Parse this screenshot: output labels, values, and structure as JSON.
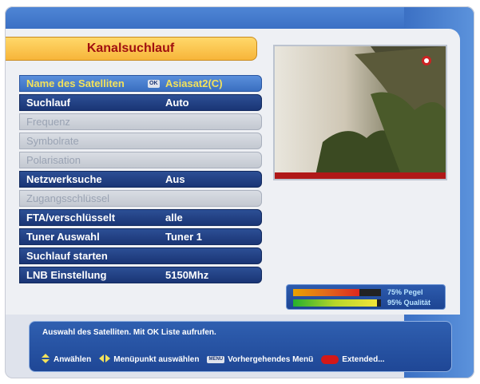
{
  "menu": {
    "title": "Kanalsuchlauf",
    "rows": [
      {
        "label": "Name des Satelliten",
        "value": "Asiasat2(C)",
        "badge": "OK",
        "state": "selected"
      },
      {
        "label": "Suchlauf",
        "value": "Auto",
        "state": "enabled"
      },
      {
        "label": "Frequenz",
        "value": "",
        "state": "disabled"
      },
      {
        "label": "Symbolrate",
        "value": "",
        "state": "disabled"
      },
      {
        "label": "Polarisation",
        "value": "",
        "state": "disabled"
      },
      {
        "label": "Netzwerksuche",
        "value": "Aus",
        "state": "enabled"
      },
      {
        "label": "Zugangsschlüssel",
        "value": "",
        "state": "disabled"
      },
      {
        "label": "FTA/verschlüsselt",
        "value": "alle",
        "state": "enabled"
      },
      {
        "label": "Tuner Auswahl",
        "value": "Tuner 1",
        "state": "enabled"
      },
      {
        "label": "Suchlauf starten",
        "value": "",
        "state": "enabled"
      },
      {
        "label": "LNB Einstellung",
        "value": "5150Mhz",
        "state": "enabled"
      }
    ]
  },
  "signal": {
    "level_text": "75% Pegel",
    "level": 0.75,
    "quality_text": "95% Qualität",
    "quality": 0.95
  },
  "help": {
    "text": "Auswahl des Satelliten. Mit OK Liste aufrufen.",
    "legend": {
      "navigate_label": "Anwählen",
      "select_label": "Menüpunkt auswählen",
      "menu_key": "MENU",
      "back_label": "Vorhergehendes Menü",
      "extended_label": "Extended..."
    }
  },
  "colors": {
    "title_text": "#a01010",
    "selected_text": "#f3e25b",
    "row_bg": "#1a3575",
    "red_key": "#d31818"
  }
}
